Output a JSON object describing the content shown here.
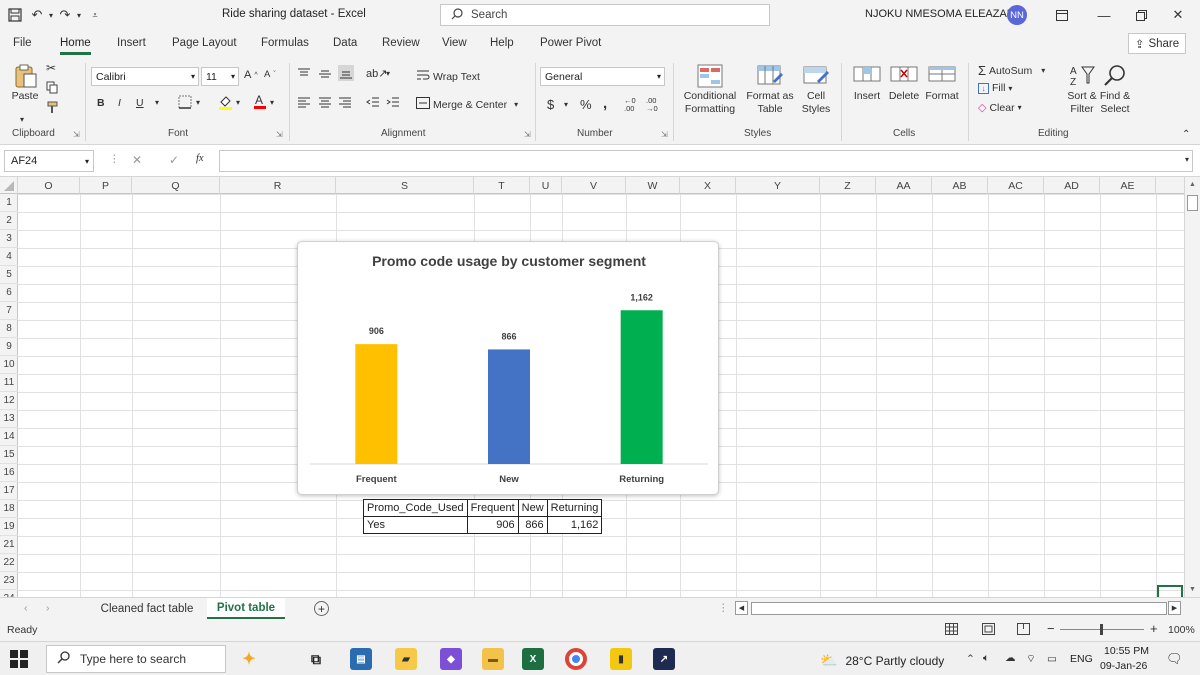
{
  "title_bar": {
    "doc_title": "Ride sharing dataset  -  Excel",
    "search_placeholder": "Search",
    "user_name": "NJOKU NMESOMA ELEAZAR",
    "user_initials": "NN"
  },
  "ribbon_tabs": [
    "File",
    "Home",
    "Insert",
    "Page Layout",
    "Formulas",
    "Data",
    "Review",
    "View",
    "Help",
    "Power Pivot"
  ],
  "active_tab": "Home",
  "share_label": "Share",
  "ribbon": {
    "paste_label": "Paste",
    "font_name": "Calibri",
    "font_size": "11",
    "wrap_text": "Wrap Text",
    "merge_center": "Merge & Center",
    "number_format": "General",
    "conditional_formatting": "Conditional Formatting",
    "format_as_table": "Format as Table",
    "cell_styles": "Cell Styles",
    "insert": "Insert",
    "delete": "Delete",
    "format": "Format",
    "autosum": "AutoSum",
    "fill": "Fill",
    "clear": "Clear",
    "sort_filter": "Sort & Filter",
    "find_select": "Find & Select",
    "groups": {
      "clipboard": "Clipboard",
      "font": "Font",
      "alignment": "Alignment",
      "number": "Number",
      "styles": "Styles",
      "cells": "Cells",
      "editing": "Editing"
    }
  },
  "formula_bar": {
    "name_box": "AF24",
    "fx": "fx",
    "content": ""
  },
  "columns": [
    "O",
    "P",
    "Q",
    "R",
    "S",
    "T",
    "U",
    "V",
    "W",
    "X",
    "Y",
    "Z",
    "AA",
    "AB",
    "AC",
    "AD",
    "AE"
  ],
  "rows": [
    "1",
    "2",
    "3",
    "4",
    "5",
    "6",
    "7",
    "8",
    "9",
    "10",
    "11",
    "12",
    "13",
    "14",
    "15",
    "16",
    "17",
    "18",
    "19",
    "21",
    "22",
    "23",
    "24"
  ],
  "chart_data": {
    "type": "bar",
    "title": "Promo code usage by customer segment",
    "categories": [
      "Frequent",
      "New",
      "Returning"
    ],
    "values": [
      906,
      866,
      1162
    ],
    "value_labels": [
      "906",
      "866",
      "1,162"
    ],
    "colors": [
      "#FFC000",
      "#4472C4",
      "#00B050"
    ],
    "ylim": [
      0,
      1300
    ],
    "grid": false,
    "legend": "none"
  },
  "pivot_table": {
    "header": [
      "Promo_Code_Used",
      "Frequent",
      "New",
      "Returning"
    ],
    "row": [
      "Yes",
      "906",
      "866",
      "1,162"
    ]
  },
  "sheets": [
    "Cleaned fact table",
    "Pivot table"
  ],
  "active_sheet": "Pivot table",
  "status": {
    "text": "Ready",
    "zoom": "100%"
  },
  "taskbar": {
    "search_placeholder": "Type here to search",
    "weather": "28°C  Partly cloudy",
    "language": "ENG",
    "time": "10:55 PM",
    "date": "09-Jan-26"
  }
}
